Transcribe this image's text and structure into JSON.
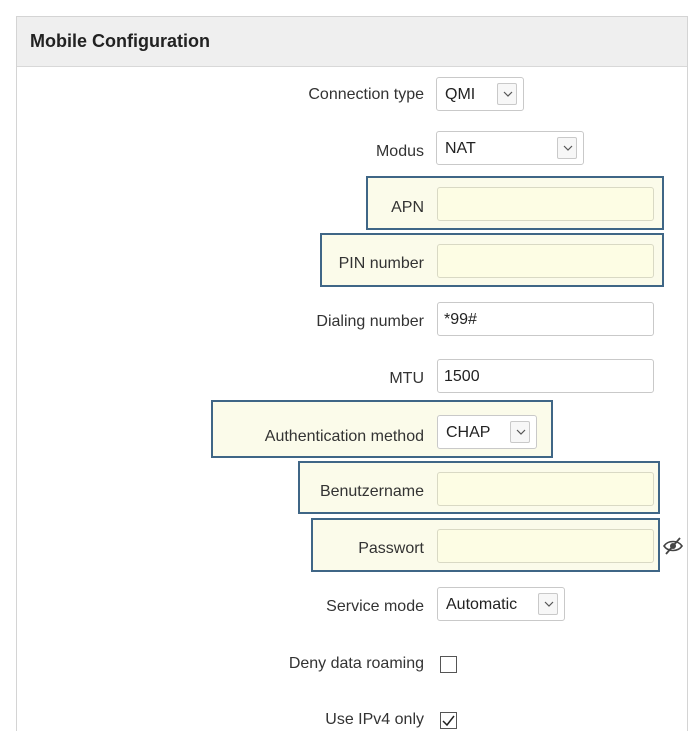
{
  "panel": {
    "title": "Mobile Configuration"
  },
  "fields": {
    "connection_type": {
      "label": "Connection type",
      "value": "QMI"
    },
    "modus": {
      "label": "Modus",
      "value": "NAT"
    },
    "apn": {
      "label": "APN",
      "value": ""
    },
    "pin": {
      "label": "PIN number",
      "value": ""
    },
    "dialing": {
      "label": "Dialing number",
      "value": "*99#"
    },
    "mtu": {
      "label": "MTU",
      "value": "1500"
    },
    "auth": {
      "label": "Authentication method",
      "value": "CHAP"
    },
    "username": {
      "label": "Benutzername",
      "value": ""
    },
    "password": {
      "label": "Passwort",
      "value": ""
    },
    "service_mode": {
      "label": "Service mode",
      "value": "Automatic"
    },
    "deny_roaming": {
      "label": "Deny data roaming",
      "checked": false
    },
    "ipv4_only": {
      "label": "Use IPv4 only",
      "checked": true
    }
  },
  "colors": {
    "highlight_border": "#3f6686",
    "highlight_fill": "#fbfbea",
    "header_bg": "#efefef"
  }
}
